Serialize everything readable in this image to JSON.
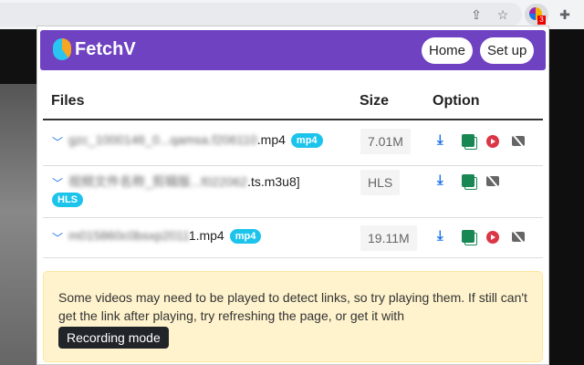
{
  "header": {
    "brand": "FetchV",
    "home": "Home",
    "setup": "Set up"
  },
  "extension": {
    "badge": "3"
  },
  "table": {
    "columns": [
      "Files",
      "Size",
      "Option"
    ],
    "rows": [
      {
        "name_blurred": "gzc_1000146_0...qamsa.f206110",
        "ext": ".mp4",
        "tag": "mp4",
        "size": "7.01M",
        "actions": [
          "download",
          "copy",
          "play",
          "record"
        ]
      },
      {
        "name_blurred": "视频文件名称_剪辑版...f022062",
        "ext": ".ts.m3u8]",
        "tag": "HLS",
        "size": "HLS",
        "actions": [
          "download",
          "copy",
          "record"
        ]
      },
      {
        "name_blurred": "m015860c0bsxp2011",
        "ext": "1.mp4",
        "tag": "mp4",
        "size": "19.11M",
        "actions": [
          "download",
          "copy",
          "play",
          "record"
        ]
      }
    ]
  },
  "notice": {
    "text": "Some videos may need to be played to detect links, so try playing them. If still can't get the link after playing, try refreshing the page, or get it with",
    "button": "Recording mode"
  }
}
